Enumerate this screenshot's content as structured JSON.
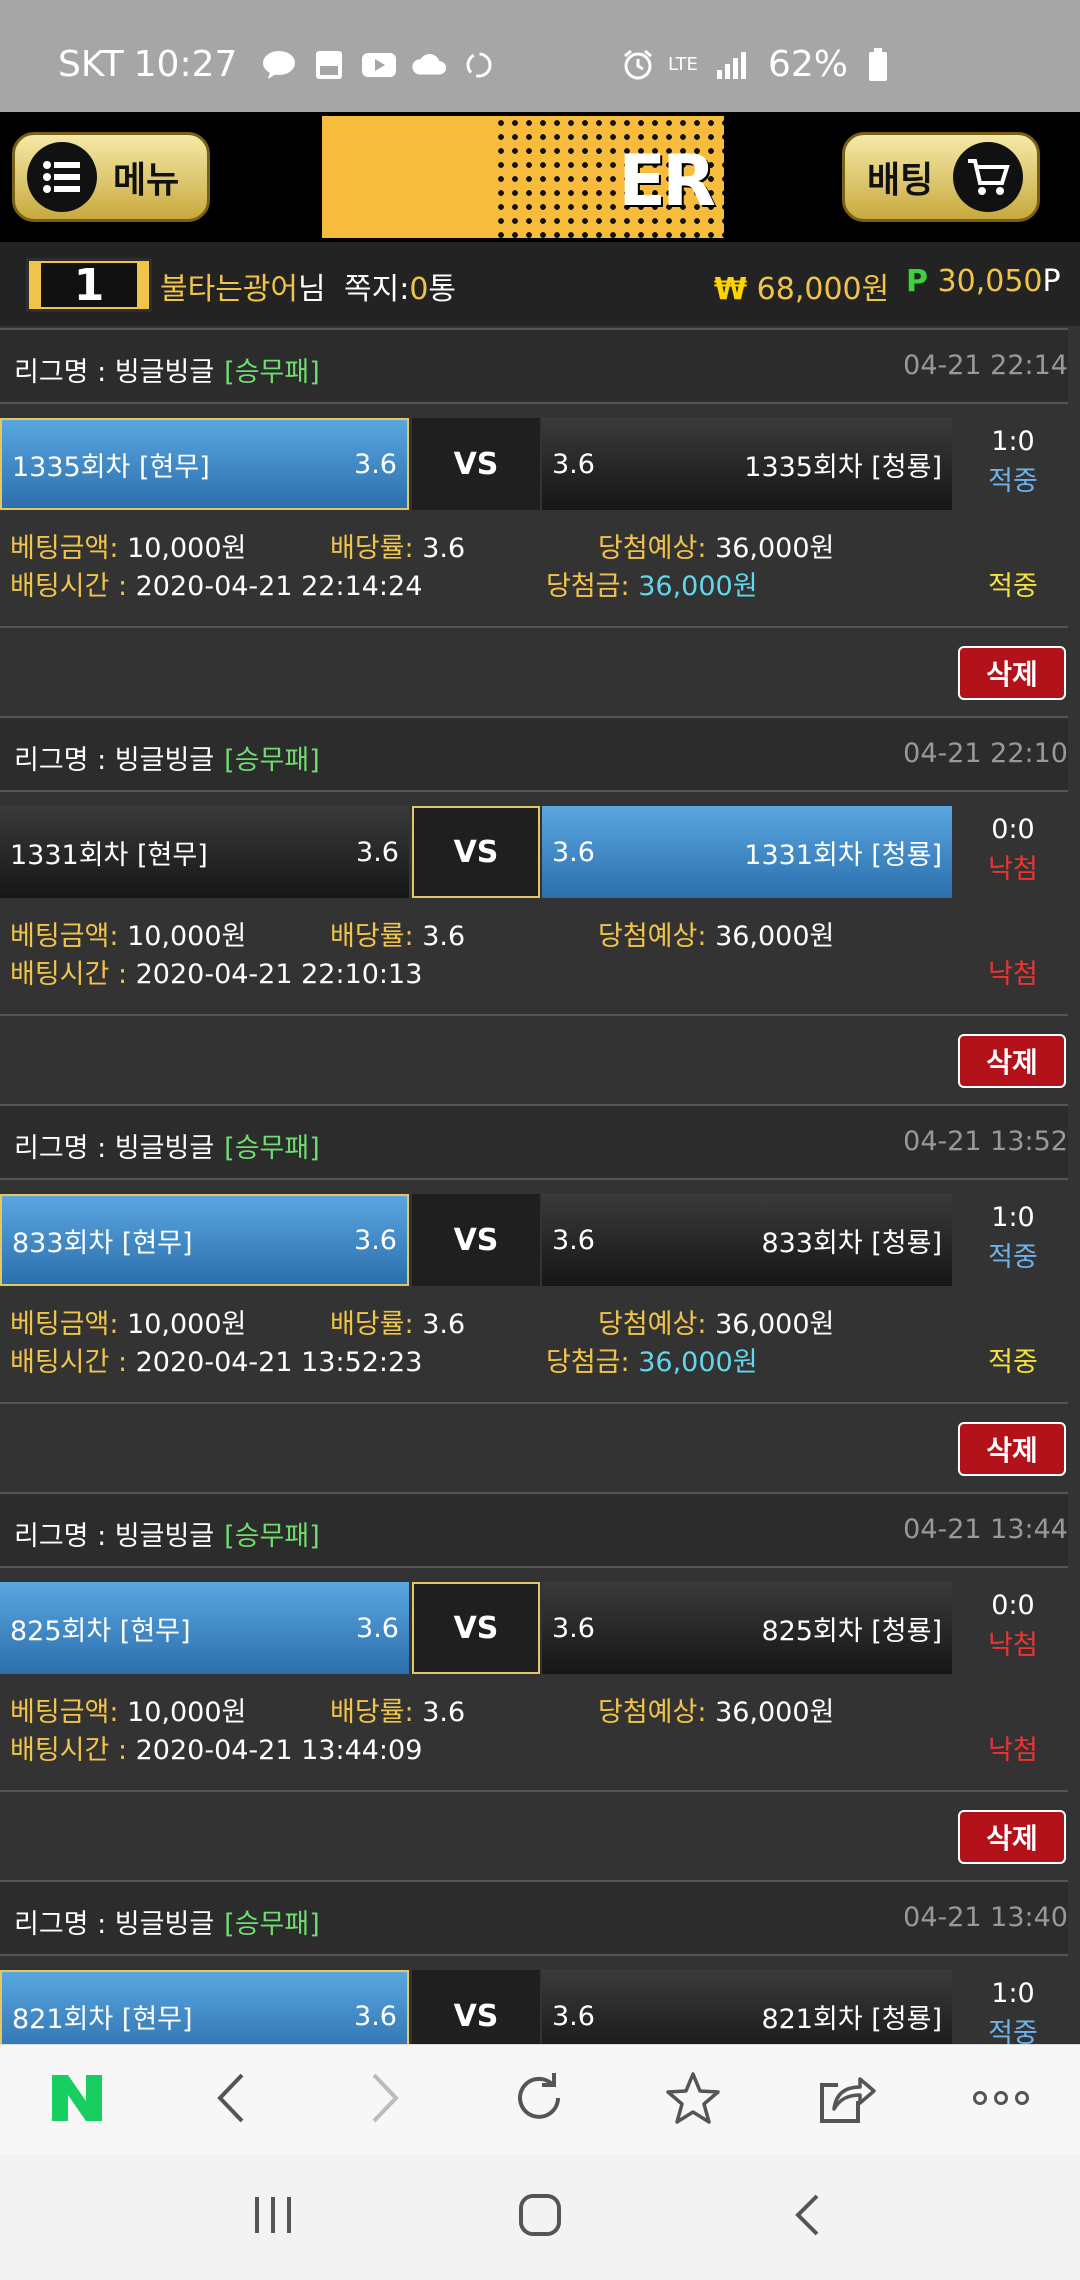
{
  "status_bar": {
    "carrier": "SKT",
    "time": "10:27",
    "network": "LTE",
    "battery": "62%"
  },
  "header": {
    "menu_label": "메뉴",
    "bet_label": "배팅",
    "logo_text": "ER"
  },
  "user": {
    "level": "1",
    "name": "불타는광어",
    "name_suffix": "님",
    "message_label": "쪽지:",
    "message_count": "0",
    "message_unit": "통",
    "currency_icon": "₩",
    "money": "68,000원",
    "points_icon": "P",
    "points": "30,050",
    "points_unit": "P"
  },
  "labels": {
    "league_prefix": "리그명 : ",
    "vs": "VS",
    "amount": "베팅금액:",
    "odds": "배당률:",
    "expected": "당첨예상:",
    "time": "배팅시간 : ",
    "winnings": "당첨금:",
    "delete": "삭제"
  },
  "bets": [
    {
      "league": "빙글빙글",
      "type": "[승무패]",
      "date": "04-21 22:14",
      "home": "1335회차 [현무]",
      "home_odds": "3.6",
      "away": "1335회차 [청룡]",
      "away_odds": "3.6",
      "score": "1:0",
      "result": "적중",
      "amount": "10,000원",
      "odds": "3.6",
      "expected": "36,000원",
      "bet_time": "2020-04-21 22:14:24",
      "winnings": "36,000원",
      "status": "적중"
    },
    {
      "league": "빙글빙글",
      "type": "[승무패]",
      "date": "04-21 22:10",
      "home": "1331회차 [현무]",
      "home_odds": "3.6",
      "away": "1331회차 [청룡]",
      "away_odds": "3.6",
      "score": "0:0",
      "result": "낙첨",
      "amount": "10,000원",
      "odds": "3.6",
      "expected": "36,000원",
      "bet_time": "2020-04-21 22:10:13",
      "winnings": "",
      "status": "낙첨"
    },
    {
      "league": "빙글빙글",
      "type": "[승무패]",
      "date": "04-21 13:52",
      "home": "833회차 [현무]",
      "home_odds": "3.6",
      "away": "833회차 [청룡]",
      "away_odds": "3.6",
      "score": "1:0",
      "result": "적중",
      "amount": "10,000원",
      "odds": "3.6",
      "expected": "36,000원",
      "bet_time": "2020-04-21 13:52:23",
      "winnings": "36,000원",
      "status": "적중"
    },
    {
      "league": "빙글빙글",
      "type": "[승무패]",
      "date": "04-21 13:44",
      "home": "825회차 [현무]",
      "home_odds": "3.6",
      "away": "825회차 [청룡]",
      "away_odds": "3.6",
      "score": "0:0",
      "result": "낙첨",
      "amount": "10,000원",
      "odds": "3.6",
      "expected": "36,000원",
      "bet_time": "2020-04-21 13:44:09",
      "winnings": "",
      "status": "낙첨"
    },
    {
      "league": "빙글빙글",
      "type": "[승무패]",
      "date": "04-21 13:40",
      "home": "821회차 [현무]",
      "home_odds": "3.6",
      "away": "821회차 [청룡]",
      "away_odds": "3.6",
      "score": "1:0",
      "result": "적중"
    }
  ],
  "colors": {
    "gold": "#f0c34a",
    "selected_blue": "#3d8bd0",
    "hit_blue": "#6fb0ee",
    "miss_red": "#e33333",
    "delete_red": "#b3121b"
  },
  "browser_bar": {
    "icons": [
      "naver-n-icon",
      "back-icon",
      "forward-icon",
      "refresh-icon",
      "star-icon",
      "share-icon",
      "more-icon"
    ]
  }
}
